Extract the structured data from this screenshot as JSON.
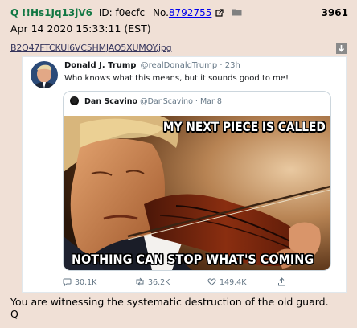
{
  "post": {
    "name": "Q",
    "tripcode": "!!Hs1Jq13jV6",
    "id_label": "ID: f0ecfc",
    "no_label": "No.",
    "no_value": "8792755",
    "post_index": "3961",
    "date": "Apr 14 2020 15:33:11 (EST)",
    "filename": "B2Q47FTCKUI6VC5HMJAQ5XUMOY.jpg",
    "message_line1": "You are witnessing the systematic destruction of the old guard.",
    "message_line2": "Q"
  },
  "tweet": {
    "display_name": "Donald J. Trump",
    "handle_time": "@realDonaldTrump · 23h",
    "text": "Who knows what this means, but it sounds good to me!",
    "quote": {
      "display_name": "Dan Scavino",
      "handle_time": "@DanScavino · Mar 8",
      "meme_top": "MY NEXT PIECE IS CALLED",
      "meme_bottom": "NOTHING CAN STOP WHAT'S COMING"
    },
    "replies": "30.1K",
    "retweets": "36.2K",
    "likes": "149.4K"
  },
  "icons": [
    "external-link-icon",
    "folder-icon",
    "download-icon",
    "reply-icon",
    "retweet-icon",
    "heart-icon",
    "share-icon"
  ],
  "colors": {
    "post_bg": "#f0e0d6",
    "name": "#117743",
    "link": "#0000ee",
    "filename": "#34345c"
  }
}
